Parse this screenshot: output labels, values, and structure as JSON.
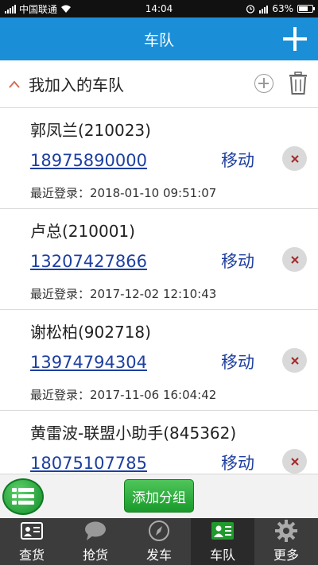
{
  "status_bar": {
    "carrier": "中国联通",
    "time": "14:04",
    "battery": "63%"
  },
  "header": {
    "title": "车队"
  },
  "section": {
    "title": "我加入的车队"
  },
  "members": [
    {
      "name": "郭凤兰(210023)",
      "phone": "18975890000",
      "carrier": "移动",
      "last_login": "最近登录：2018-01-10 09:51:07"
    },
    {
      "name": "卢总(210001)",
      "phone": "13207427866",
      "carrier": "移动",
      "last_login": "最近登录：2017-12-02 12:10:43"
    },
    {
      "name": "谢松柏(902718)",
      "phone": "13974794304",
      "carrier": "移动",
      "last_login": "最近登录：2017-11-06 16:04:42"
    },
    {
      "name": "黄雷波-联盟小助手(845362)",
      "phone": "18075107785",
      "carrier": "移动",
      "last_login": ""
    }
  ],
  "actions": {
    "add_group": "添加分组"
  },
  "tabs": [
    {
      "label": "查货",
      "icon": "cargo-card-icon"
    },
    {
      "label": "抢货",
      "icon": "chat-bubble-icon"
    },
    {
      "label": "发车",
      "icon": "compass-icon"
    },
    {
      "label": "车队",
      "icon": "fleet-card-icon",
      "active": true
    },
    {
      "label": "更多",
      "icon": "gear-icon"
    }
  ],
  "colors": {
    "header_bg": "#1a8fd8",
    "link_blue": "#1e3fa0",
    "green": "#199a2b",
    "tab_bg": "#3c3c3c"
  }
}
